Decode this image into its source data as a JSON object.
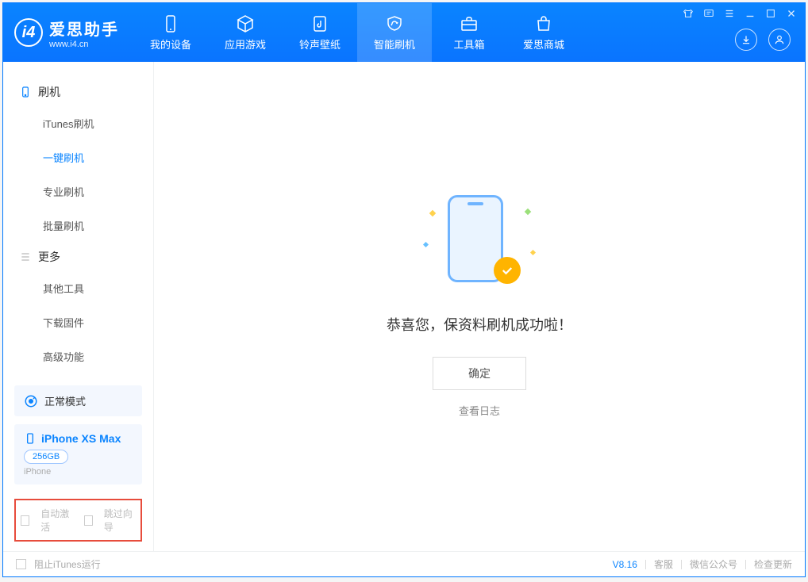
{
  "app": {
    "name": "爱思助手",
    "url": "www.i4.cn"
  },
  "tabs": {
    "device": "我的设备",
    "apps": "应用游戏",
    "ring": "铃声壁纸",
    "flash": "智能刷机",
    "tools": "工具箱",
    "store": "爱思商城"
  },
  "sidebar": {
    "group1": "刷机",
    "items1": {
      "itunes": "iTunes刷机",
      "oneclick": "一键刷机",
      "pro": "专业刷机",
      "batch": "批量刷机"
    },
    "group2": "更多",
    "items2": {
      "other": "其他工具",
      "firmware": "下载固件",
      "advanced": "高级功能"
    }
  },
  "mode": {
    "label": "正常模式"
  },
  "device": {
    "name": "iPhone XS Max",
    "storage": "256GB",
    "type": "iPhone"
  },
  "checks": {
    "autoactivate": "自动激活",
    "skipguide": "跳过向导"
  },
  "main": {
    "success": "恭喜您，保资料刷机成功啦！",
    "ok": "确定",
    "viewlog": "查看日志"
  },
  "footer": {
    "blockitunes": "阻止iTunes运行",
    "version": "V8.16",
    "support": "客服",
    "wechat": "微信公众号",
    "update": "检查更新"
  }
}
